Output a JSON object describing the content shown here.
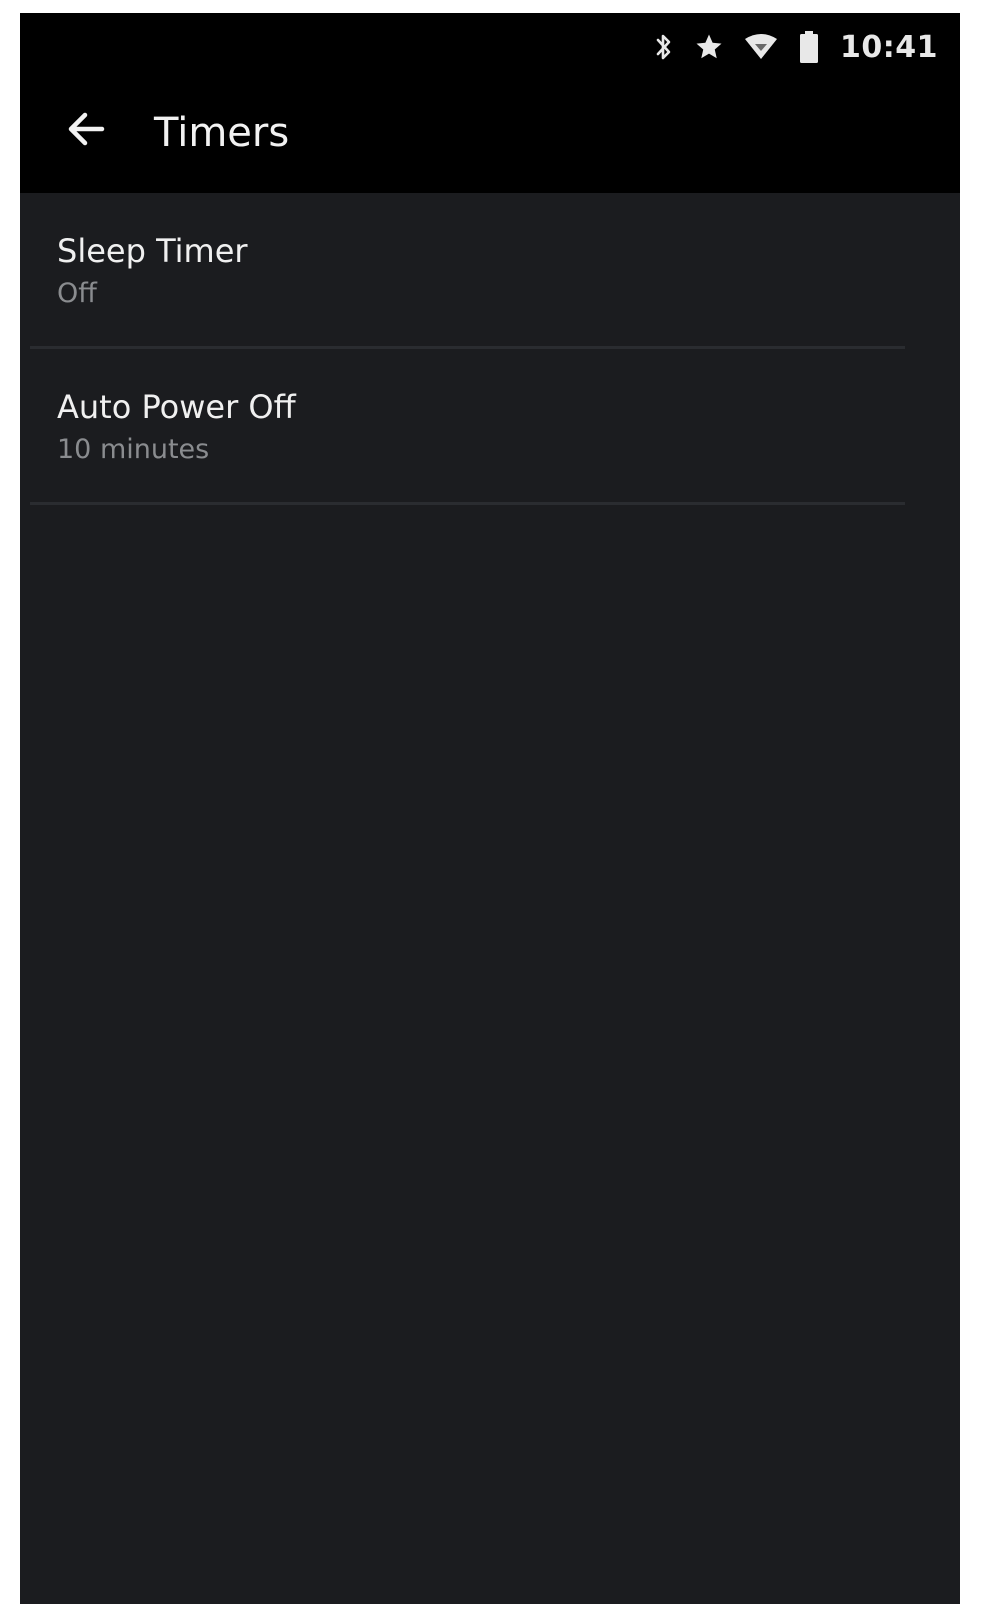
{
  "status_bar": {
    "time": "10:41",
    "icons": [
      "bluetooth-icon",
      "star-icon",
      "wifi-icon",
      "battery-icon"
    ]
  },
  "header": {
    "back_icon": "arrow-left-icon",
    "title": "Timers"
  },
  "settings": [
    {
      "label": "Sleep Timer",
      "value": "Off"
    },
    {
      "label": "Auto Power Off",
      "value": "10 minutes"
    }
  ],
  "colors": {
    "background": "#1b1c1f",
    "header": "#000000",
    "primary_text": "#f0f0f0",
    "secondary_text": "#8a8c8f"
  }
}
